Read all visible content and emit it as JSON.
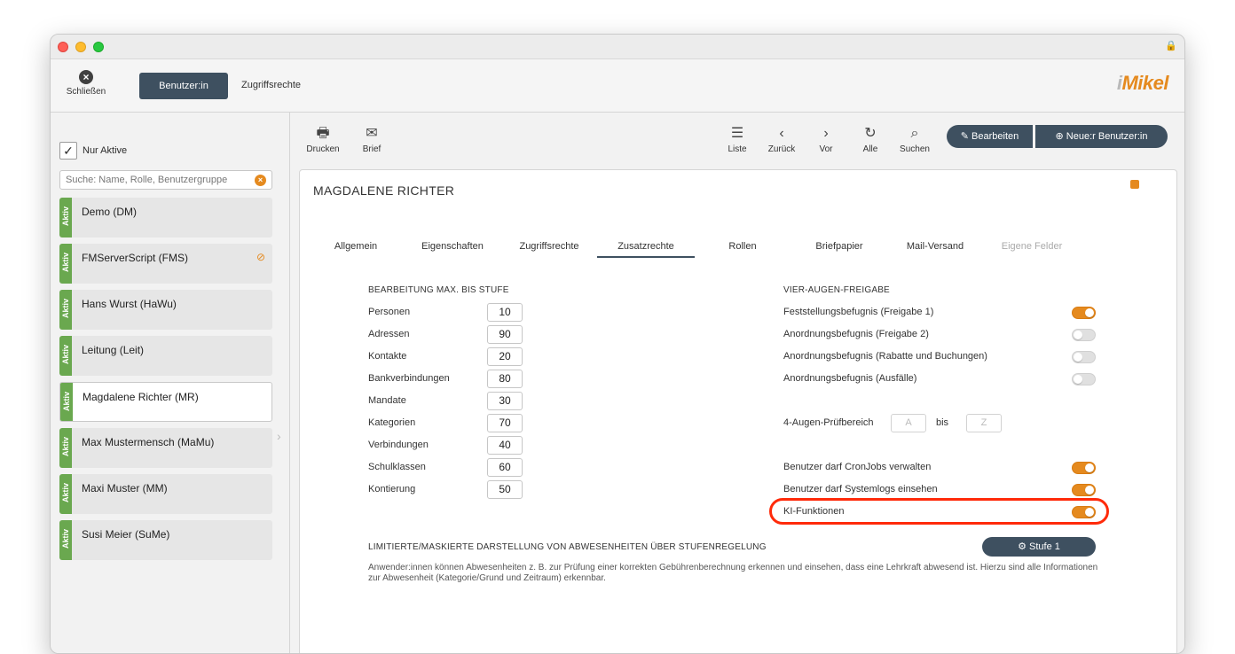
{
  "window": {
    "colors": {
      "accent": "#e58a1f",
      "primary": "#3e5060",
      "active": "#6aa84f",
      "highlight": "#ff2a0a"
    }
  },
  "topbar": {
    "close_label": "Schließen",
    "close_icon": "close-circle-icon",
    "tabs": [
      {
        "label": "Benutzer:in",
        "active": true
      },
      {
        "label": "Zugriffsrechte",
        "active": false
      }
    ],
    "logo": {
      "i": "i",
      "rest": "Mikel"
    }
  },
  "sidebar": {
    "filter_label": "Nur Aktive",
    "filter_checked": true,
    "search_placeholder": "Suche: Name, Rolle, Benutzergruppe",
    "users": [
      {
        "status": "Aktiv",
        "name": "Demo (DM)"
      },
      {
        "status": "Aktiv",
        "name": "FMServerScript (FMS)",
        "hidden": true
      },
      {
        "status": "Aktiv",
        "name": "Hans Wurst (HaWu)"
      },
      {
        "status": "Aktiv",
        "name": "Leitung (Leit)"
      },
      {
        "status": "Aktiv",
        "name": "Magdalene Richter (MR)",
        "selected": true
      },
      {
        "status": "Aktiv",
        "name": "Max Mustermensch (MaMu)"
      },
      {
        "status": "Aktiv",
        "name": "Maxi Muster (MM)"
      },
      {
        "status": "Aktiv",
        "name": "Susi Meier (SuMe)"
      }
    ]
  },
  "toolbar": {
    "print": "Drucken",
    "letter": "Brief",
    "list": "Liste",
    "back": "Zurück",
    "forward": "Vor",
    "all": "Alle",
    "search": "Suchen",
    "edit": "Bearbeiten",
    "new_user": "Neue:r Benutzer:in"
  },
  "detail": {
    "title": "MAGDALENE RICHTER",
    "tabs": [
      "Allgemein",
      "Eigenschaften",
      "Zugriffsrechte",
      "Zusatzrechte",
      "Rollen",
      "Briefpapier",
      "Mail-Versand",
      "Eigene Felder"
    ],
    "active_tab": "Zusatzrechte",
    "disabled_tab": "Eigene Felder",
    "left_section": {
      "heading": "BEARBEITUNG MAX. BIS STUFE",
      "rows": [
        {
          "label": "Personen",
          "value": "10"
        },
        {
          "label": "Adressen",
          "value": "90"
        },
        {
          "label": "Kontakte",
          "value": "20"
        },
        {
          "label": "Bankverbindungen",
          "value": "80"
        },
        {
          "label": "Mandate",
          "value": "30"
        },
        {
          "label": "Kategorien",
          "value": "70"
        },
        {
          "label": "Verbindungen",
          "value": "40"
        },
        {
          "label": "Schulklassen",
          "value": "60"
        },
        {
          "label": "Kontierung",
          "value": "50"
        }
      ]
    },
    "right_section": {
      "heading": "VIER-AUGEN-FREIGABE",
      "toggles": [
        {
          "label": "Feststellungsbefugnis (Freigabe 1)",
          "on": true
        },
        {
          "label": "Anordnungsbefugnis (Freigabe 2)",
          "on": false
        },
        {
          "label": "Anordnungsbefugnis (Rabatte und Buchungen)",
          "on": false
        },
        {
          "label": "Anordnungsbefugnis (Ausfälle)",
          "on": false
        }
      ],
      "range_label": "4-Augen-Prüfbereich",
      "range_from": "A",
      "range_sep": "bis",
      "range_to": "Z",
      "extra_toggles": [
        {
          "label": "Benutzer darf CronJobs verwalten",
          "on": true
        },
        {
          "label": "Benutzer darf Systemlogs einsehen",
          "on": true
        },
        {
          "label": "KI-Funktionen",
          "on": true
        }
      ]
    },
    "absence": {
      "heading": "LIMITIERTE/MASKIERTE DARSTELLUNG VON ABWESENHEITEN ÜBER STUFENREGELUNG",
      "button": "Stufe 1",
      "description": "Anwender:innen können Abwesenheiten z. B. zur Prüfung einer korrekten Gebührenberechnung erkennen und einsehen, dass eine Lehrkraft abwesend ist. Hierzu sind alle Informationen zur Abwesenheit (Kategorie/Grund und Zeitraum) erkennbar."
    }
  }
}
